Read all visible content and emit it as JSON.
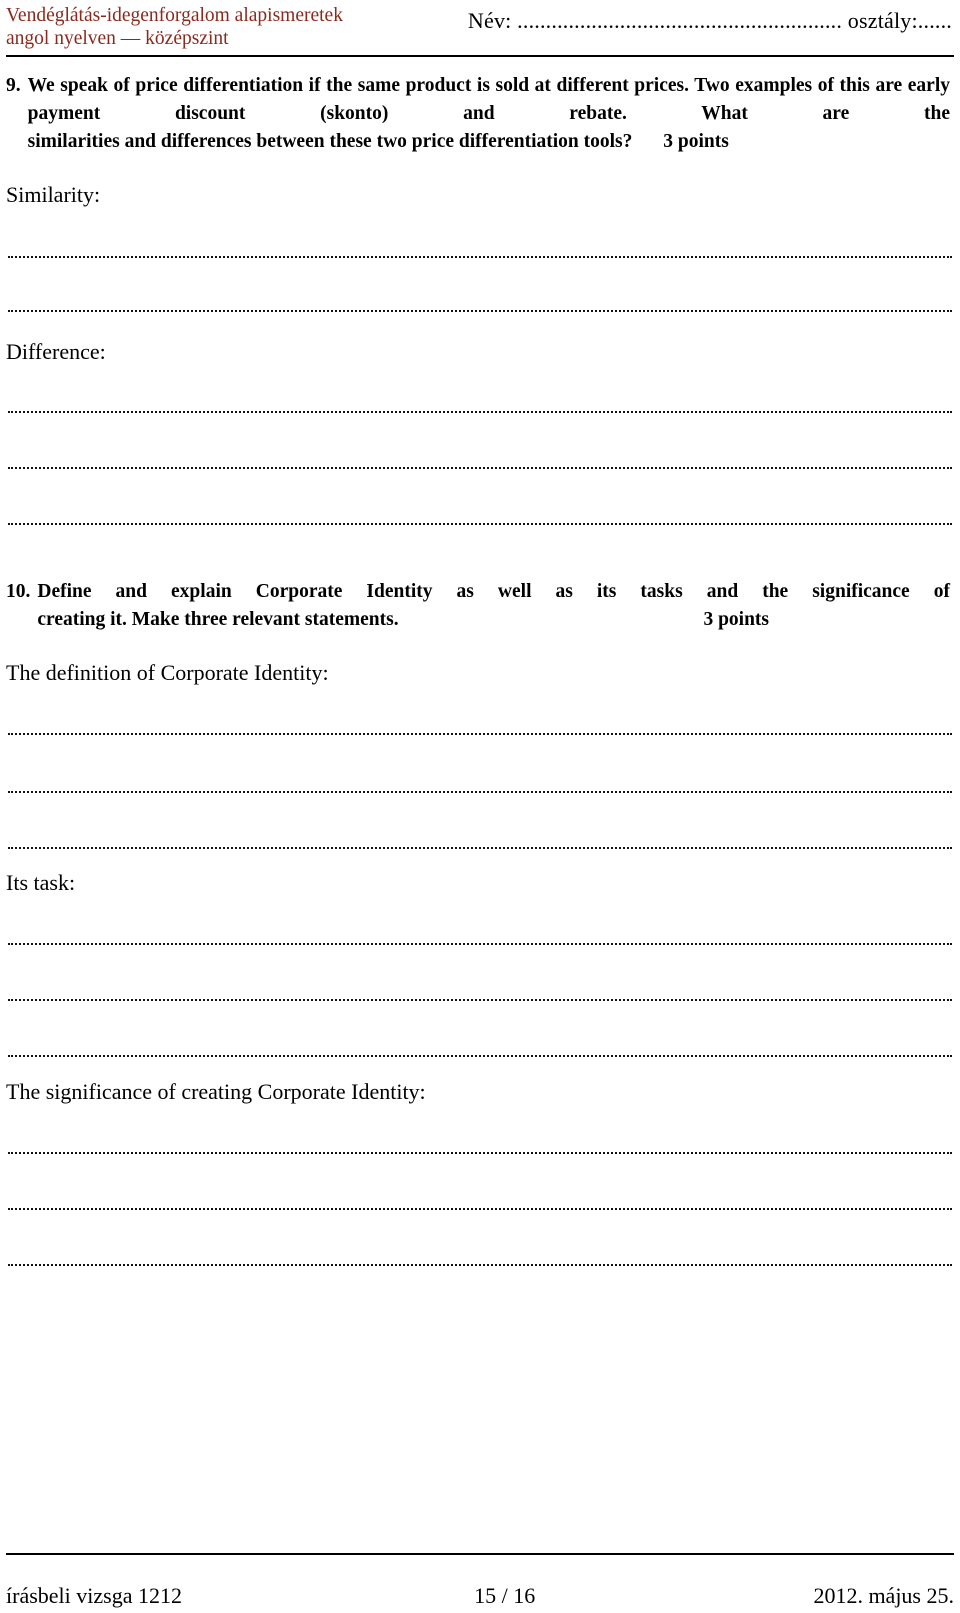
{
  "header": {
    "subject_line1": "Vendéglátás-idegenforgalom alapismeretek",
    "subject_line2": "angol nyelven — középszint",
    "subject_color": "#8a2a1e",
    "name_field": "Név: ......................................................... osztály:......"
  },
  "questions": [
    {
      "number": "9.",
      "text_line1": "We speak of price differentiation if the same product is sold at different prices. Two",
      "text_line2": "examples of this are early payment discount (skonto) and rebate. What are the",
      "text_line3": "similarities and differences between these two price differentiation tools?",
      "points": "3 points",
      "fields": [
        {
          "label": "Similarity:",
          "lines": 2
        },
        {
          "label": "Difference:",
          "lines": 3
        }
      ]
    },
    {
      "number": "10.",
      "text_line1": "Define and explain Corporate Identity as well as its tasks and the significance of",
      "text_line2": "creating it. Make three relevant statements.",
      "points": "3 points",
      "fields": [
        {
          "label": "The definition of Corporate Identity:",
          "lines": 3
        },
        {
          "label": "Its task:",
          "lines": 3
        },
        {
          "label": "The significance of creating Corporate Identity:",
          "lines": 3
        }
      ]
    }
  ],
  "footer": {
    "left": "írásbeli vizsga 1212",
    "center": "15 / 16",
    "right": "2012. május 25."
  }
}
